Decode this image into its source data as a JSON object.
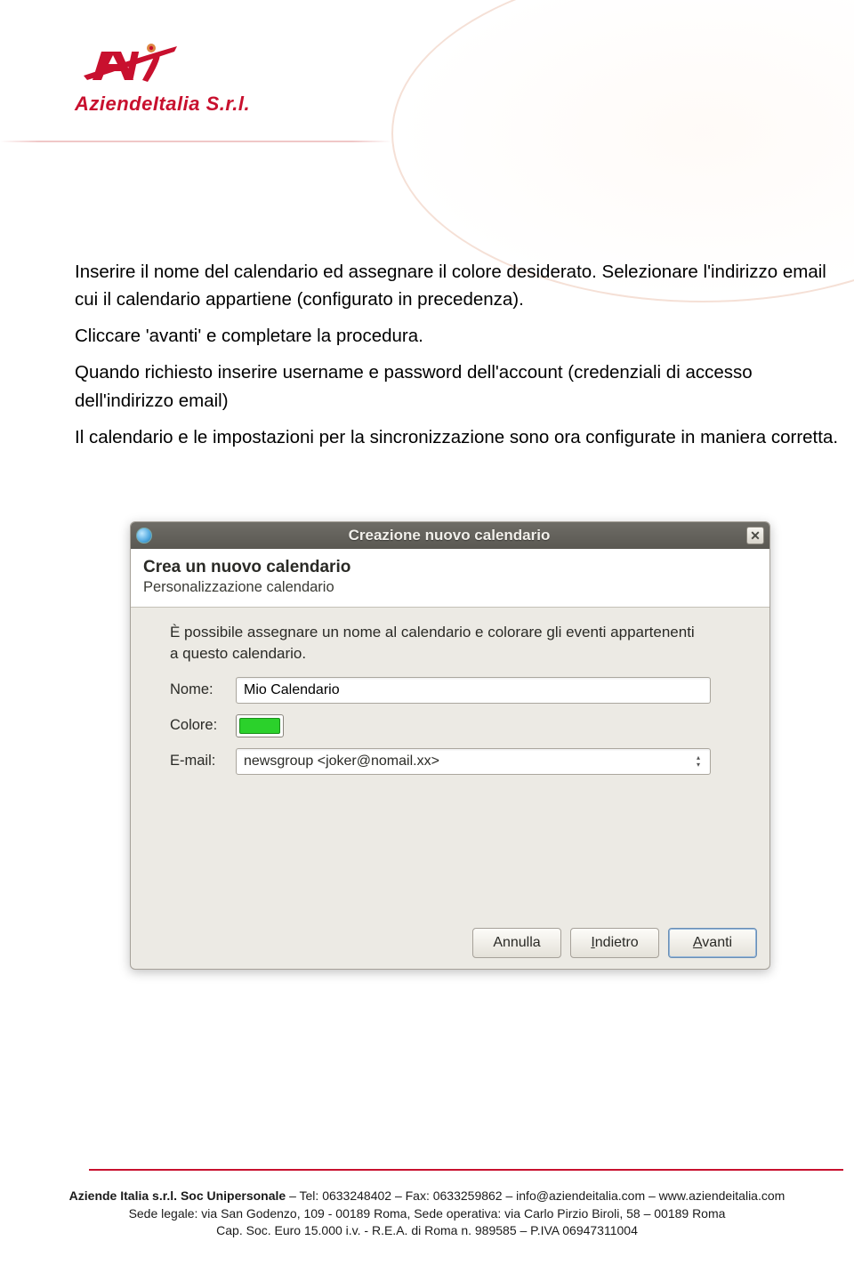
{
  "logo": {
    "company": "AziendeItalia S.r.l."
  },
  "body": {
    "p1": "Inserire il nome del calendario ed assegnare il colore desiderato. Selezionare l'indirizzo email cui il calendario appartiene (configurato in precedenza).",
    "p2": "Cliccare 'avanti' e completare la procedura.",
    "p3": "Quando richiesto inserire username e password dell'account (credenziali di accesso dell'indirizzo email)",
    "p4": "Il calendario e le impostazioni per la sincronizzazione sono ora configurate in maniera corretta."
  },
  "dialog": {
    "title": "Creazione nuovo calendario",
    "heading": "Crea un nuovo calendario",
    "subheading": "Personalizzazione calendario",
    "description": "È possibile assegnare un nome al calendario e colorare gli eventi appartenenti a questo calendario.",
    "fields": {
      "name_label": "Nome:",
      "name_value": "Mio Calendario",
      "color_label": "Colore:",
      "color_value": "#2bd12b",
      "email_label": "E-mail:",
      "email_value": "newsgroup <joker@nomail.xx>"
    },
    "buttons": {
      "cancel": "Annulla",
      "back_prefix": "I",
      "back_rest": "ndietro",
      "next_prefix": "A",
      "next_rest": "vanti"
    }
  },
  "footer": {
    "line1a": "Aziende Italia s.r.l. Soc Unipersonale",
    "line1b": " – Tel: 0633248402 – Fax: 0633259862 –  info@aziendeitalia.com – www.aziendeitalia.com",
    "line2": "Sede legale: via San Godenzo, 109 - 00189 Roma, Sede operativa: via Carlo Pirzio Biroli, 58 – 00189 Roma",
    "line3": "Cap. Soc. Euro 15.000 i.v. - R.E.A. di Roma n. 989585 – P.IVA 06947311004"
  }
}
